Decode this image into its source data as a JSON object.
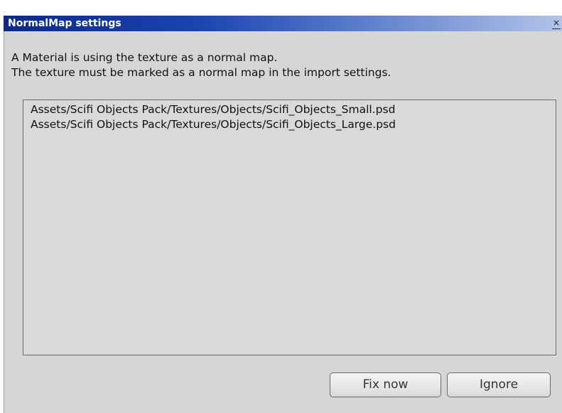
{
  "window": {
    "title": "NormalMap settings",
    "close_glyph": "×"
  },
  "message": {
    "line1": "A Material is using the texture as a normal map.",
    "line2": "The texture must be marked as a normal map in the import settings."
  },
  "assets": [
    "Assets/Scifi Objects Pack/Textures/Objects/Scifi_Objects_Small.psd",
    "Assets/Scifi Objects Pack/Textures/Objects/Scifi_Objects_Large.psd"
  ],
  "buttons": {
    "fix_now": "Fix now",
    "ignore": "Ignore"
  },
  "colors": {
    "titlebar_start": "#0a2a8a",
    "titlebar_end": "#b3c4e8",
    "dialog_bg": "#d6d6d6"
  }
}
